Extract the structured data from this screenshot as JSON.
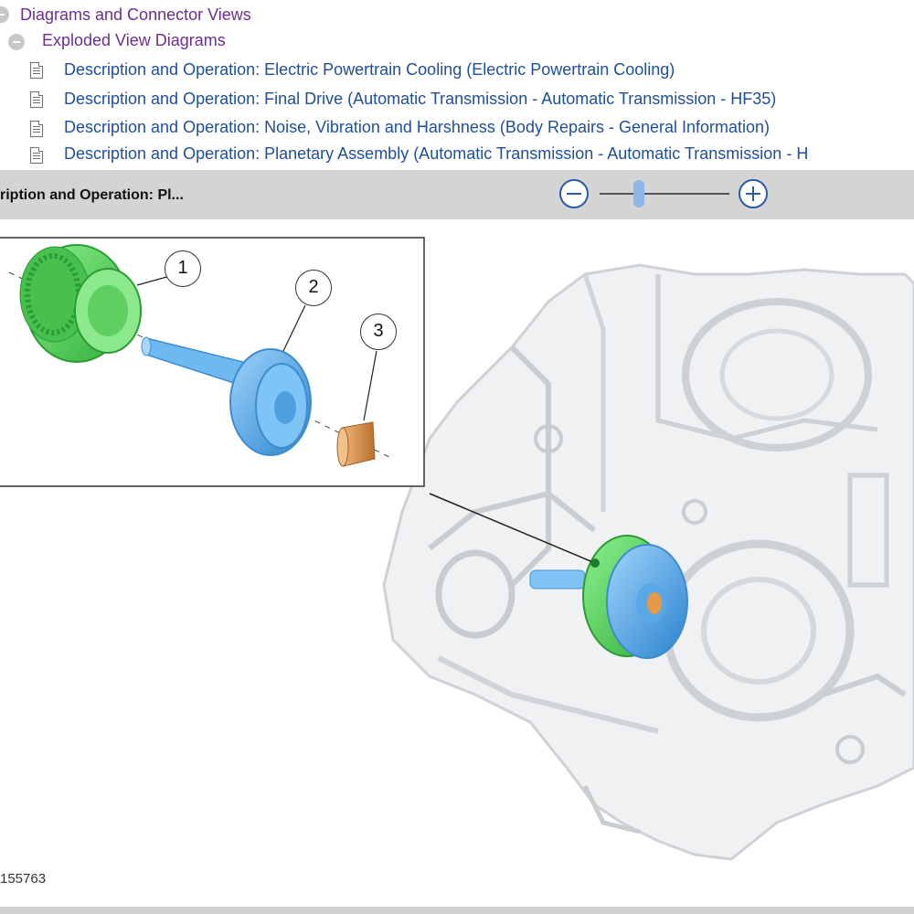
{
  "tree": {
    "parent_label": "Diagrams and Connector Views",
    "folder_label": "Exploded View Diagrams",
    "items": [
      {
        "label": "Description and Operation: Electric Powertrain Cooling (Electric Powertrain Cooling)"
      },
      {
        "label": "Description and Operation: Final Drive (Automatic Transmission - Automatic Transmission - HF35)"
      },
      {
        "label": "Description and Operation: Noise, Vibration and Harshness (Body Repairs - General Information)"
      },
      {
        "label": "Description and Operation: Planetary Assembly (Automatic Transmission - Automatic Transmission - H"
      }
    ]
  },
  "viewer": {
    "title": "ription and Operation: Pl...",
    "zoom_out_icon": "minus-icon",
    "zoom_in_icon": "plus-icon",
    "zoom_level": 0.3
  },
  "diagram": {
    "callouts": [
      "1",
      "2",
      "3"
    ],
    "figure_id": "155763",
    "colors": {
      "ring_gear": "#5ed65e",
      "sun_gear": "#4da6e8",
      "pinion": "#d7954e",
      "housing": "#c8ccd0"
    }
  }
}
